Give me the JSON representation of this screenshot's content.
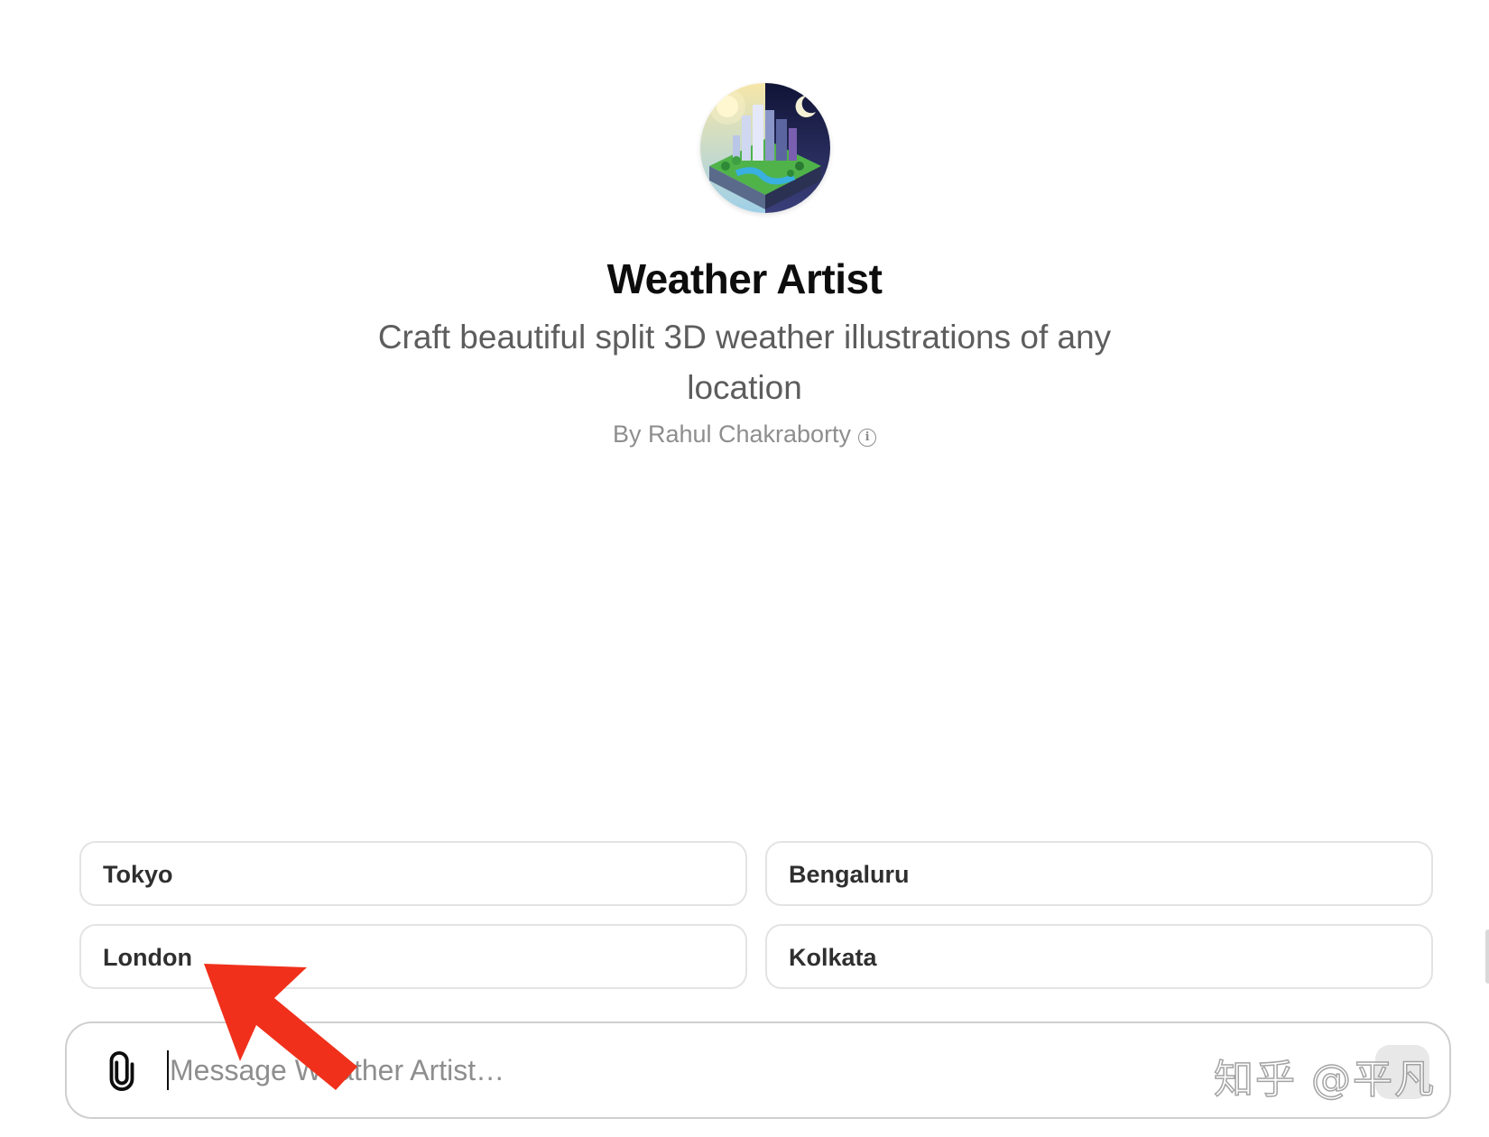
{
  "gpt": {
    "name": "Weather Artist",
    "description": "Craft beautiful split 3D weather illustrations of any location",
    "author": "By Rahul Chakraborty"
  },
  "suggestions": [
    "Tokyo",
    "Bengaluru",
    "London",
    "Kolkata"
  ],
  "composer": {
    "placeholder": "Message Weather Artist…"
  },
  "watermark": "知乎 @平凡",
  "colors": {
    "arrow": "#f0301b",
    "chip_border": "#e3e3e3",
    "composer_border": "#cfcfcf"
  }
}
